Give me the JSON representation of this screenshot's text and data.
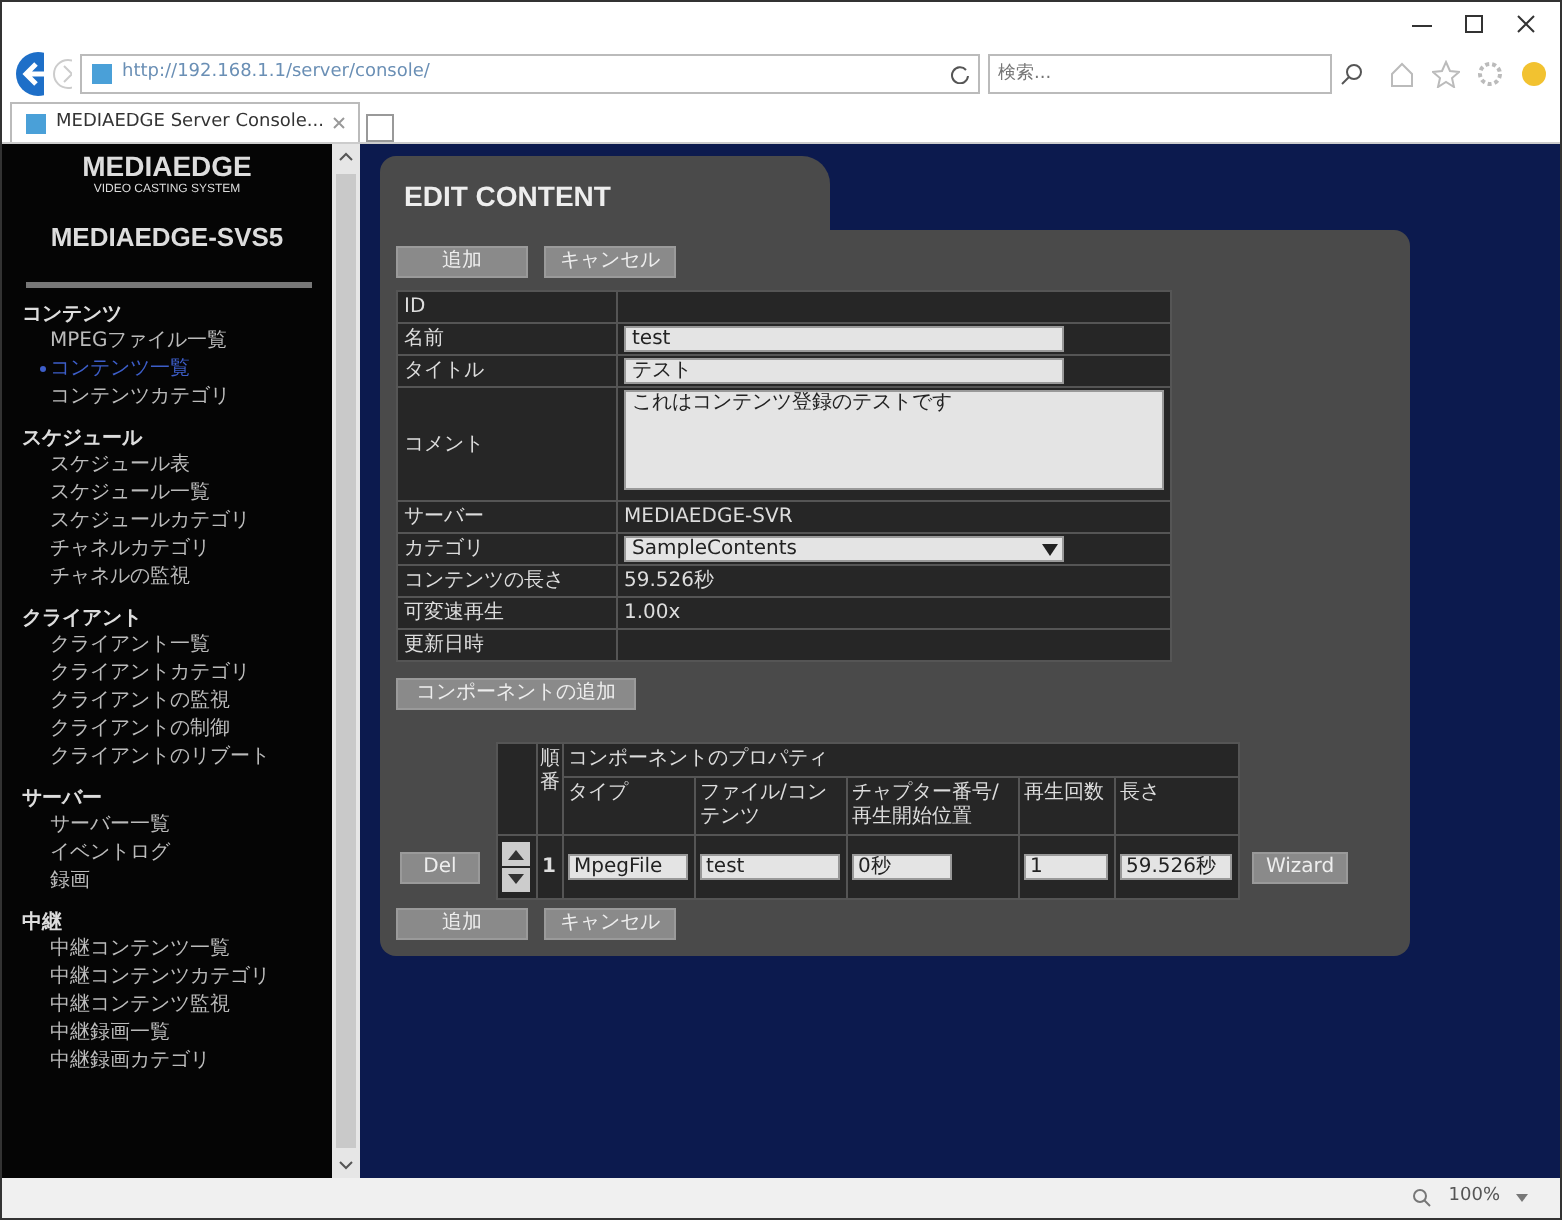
{
  "browser": {
    "address": "http://192.168.1.1/server/console/",
    "search_placeholder": "検索...",
    "tab_title": "MEDIAEDGE Server Console...",
    "zoom": "100%"
  },
  "sidebar": {
    "brand": "MEDIAEDGE",
    "tagline": "VIDEO CASTING SYSTEM",
    "server": "MEDIAEDGE-SVS5",
    "groups": [
      {
        "title": "コンテンツ",
        "items": [
          {
            "label": "MPEGファイル一覧",
            "selected": false
          },
          {
            "label": "コンテンツ一覧",
            "selected": true
          },
          {
            "label": "コンテンツカテゴリ",
            "selected": false
          }
        ]
      },
      {
        "title": "スケジュール",
        "items": [
          {
            "label": "スケジュール表",
            "selected": false
          },
          {
            "label": "スケジュール一覧",
            "selected": false
          },
          {
            "label": "スケジュールカテゴリ",
            "selected": false
          },
          {
            "label": "チャネルカテゴリ",
            "selected": false
          },
          {
            "label": "チャネルの監視",
            "selected": false
          }
        ]
      },
      {
        "title": "クライアント",
        "items": [
          {
            "label": "クライアント一覧",
            "selected": false
          },
          {
            "label": "クライアントカテゴリ",
            "selected": false
          },
          {
            "label": "クライアントの監視",
            "selected": false
          },
          {
            "label": "クライアントの制御",
            "selected": false
          },
          {
            "label": "クライアントのリブート",
            "selected": false
          }
        ]
      },
      {
        "title": "サーバー",
        "items": [
          {
            "label": "サーバー一覧",
            "selected": false
          },
          {
            "label": "イベントログ",
            "selected": false
          },
          {
            "label": "録画",
            "selected": false
          }
        ]
      },
      {
        "title": "中継",
        "items": [
          {
            "label": "中継コンテンツ一覧",
            "selected": false
          },
          {
            "label": "中継コンテンツカテゴリ",
            "selected": false
          },
          {
            "label": "中継コンテンツ監視",
            "selected": false
          },
          {
            "label": "中継録画一覧",
            "selected": false
          },
          {
            "label": "中継録画カテゴリ",
            "selected": false
          }
        ]
      }
    ]
  },
  "panel": {
    "tab": "EDIT CONTENT",
    "top_buttons": [
      "追加",
      "キャンセル"
    ],
    "fields": [
      {
        "label": "ID",
        "kind": "empty"
      },
      {
        "label": "名前",
        "kind": "input",
        "value": "test"
      },
      {
        "label": "タイトル",
        "kind": "input",
        "value": "テスト"
      },
      {
        "label": "コメント",
        "kind": "textarea",
        "value": "これはコンテンツ登録のテストです"
      },
      {
        "label": "サーバー",
        "kind": "text",
        "value": "MEDIAEDGE-SVR"
      },
      {
        "label": "カテゴリ",
        "kind": "select",
        "value": "SampleContents"
      },
      {
        "label": "コンテンツの長さ",
        "kind": "text",
        "value": "59.526秒"
      },
      {
        "label": "可変速再生",
        "kind": "text",
        "value": "1.00x"
      },
      {
        "label": "更新日時",
        "kind": "empty"
      }
    ],
    "add_component_button": "コンポーネントの追加",
    "components": {
      "order_header": "順番",
      "group_header": "コンポーネントのプロパティ",
      "columns": [
        "タイプ",
        "ファイル/コンテンツ",
        "チャプター番号/再生開始位置",
        "再生回数",
        "長さ"
      ],
      "rows": [
        {
          "delete": "Del",
          "order": "1",
          "cells": [
            "MpegFile",
            "test",
            "0秒",
            "1",
            "59.526秒"
          ],
          "wizard": "Wizard"
        }
      ]
    },
    "bottom_buttons": [
      "追加",
      "キャンセル"
    ]
  }
}
